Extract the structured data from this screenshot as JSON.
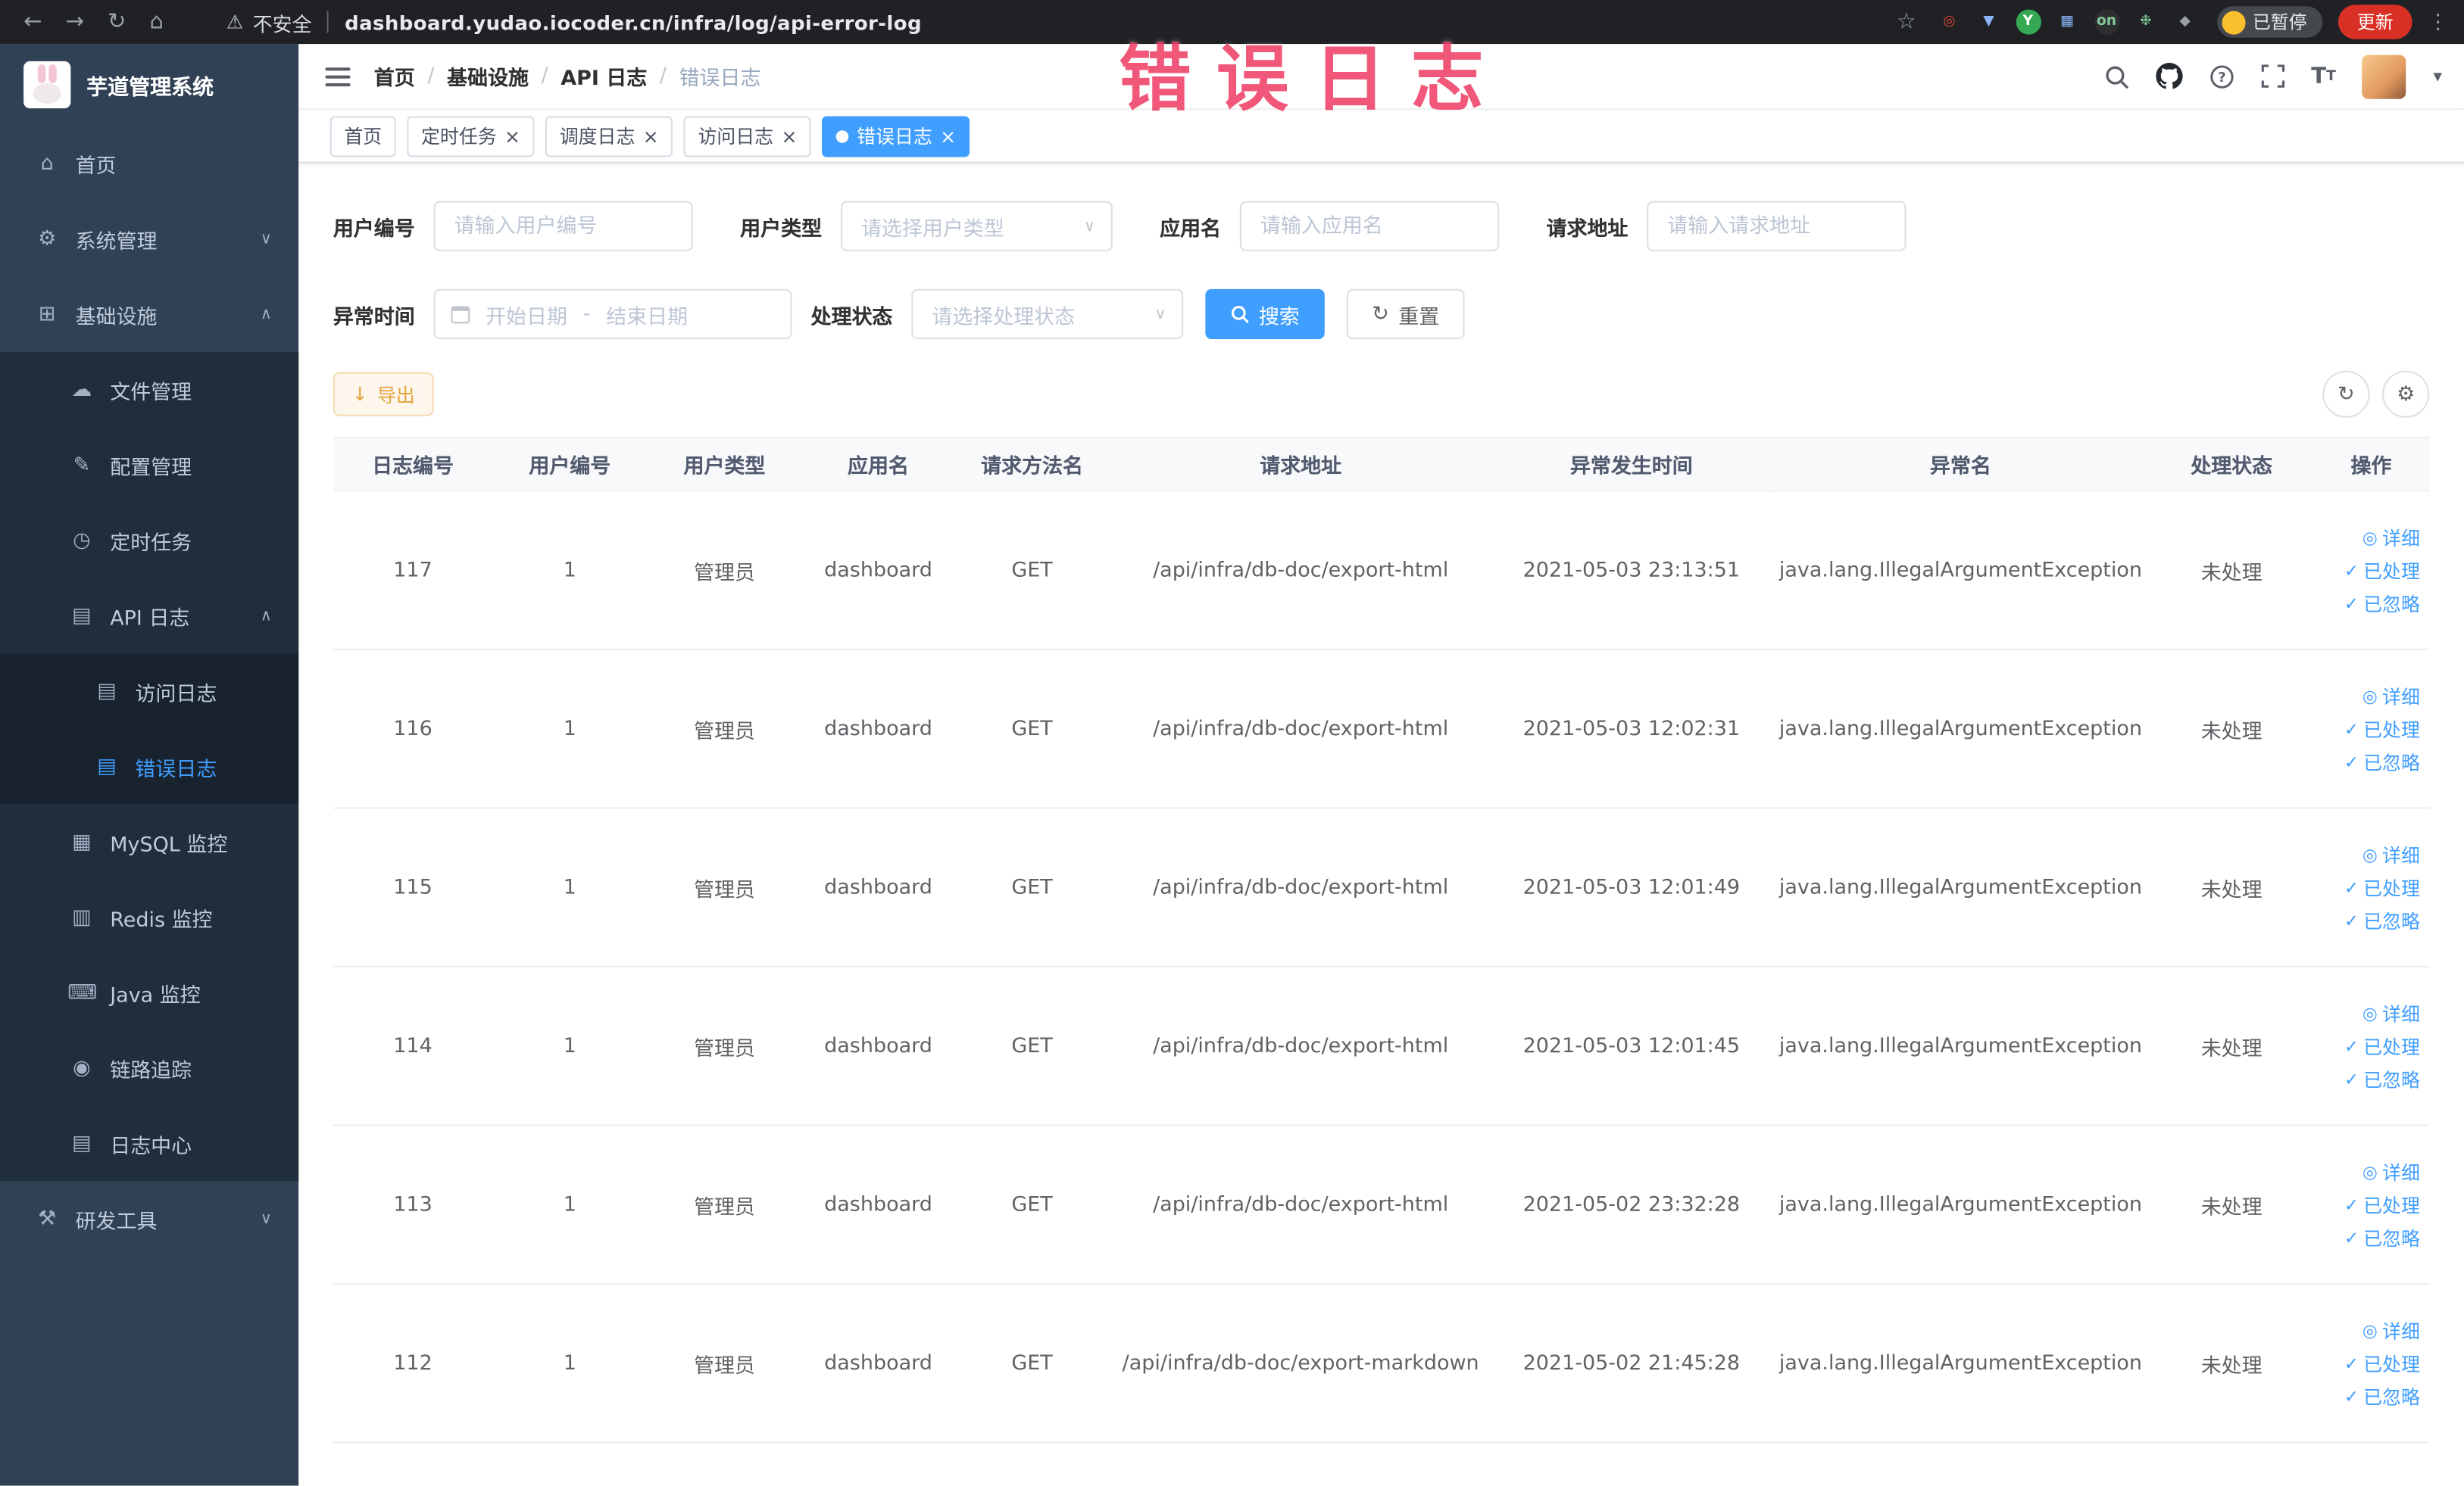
{
  "colors": {
    "accent": "#409eff",
    "warning": "#e6a23c",
    "annotation": "#ee4066",
    "sidebar_bg": "#304156",
    "submenu_bg": "#1f2d3d"
  },
  "browser": {
    "nav_icons": [
      {
        "name": "back-icon",
        "glyph": "←"
      },
      {
        "name": "forward-icon",
        "glyph": "→"
      },
      {
        "name": "reload-icon",
        "glyph": "↻"
      },
      {
        "name": "home-icon",
        "glyph": "⌂"
      }
    ],
    "security_warning_icon": "⚠",
    "security_label": "不安全",
    "url": "dashboard.yudao.iocoder.cn/infra/log/api-error-log",
    "bookmark_star_icon": "☆",
    "extensions": [
      {
        "name": "recorder-icon",
        "glyph": "◎",
        "bg": "#202124",
        "fg": "#ea4335"
      },
      {
        "name": "drop-icon",
        "glyph": "▼",
        "bg": "#202124",
        "fg": "#8ab4f8"
      },
      {
        "name": "green-app-icon",
        "glyph": "Y",
        "bg": "#34a853",
        "fg": "#ffffff"
      },
      {
        "name": "grid-app-icon",
        "glyph": "▦",
        "bg": "#202124",
        "fg": "#8ab4f8"
      },
      {
        "name": "on-badge-icon",
        "glyph": "on",
        "bg": "#2d2f31",
        "fg": "#81c995"
      },
      {
        "name": "leaf-icon",
        "glyph": "❉",
        "bg": "#202124",
        "fg": "#81c995"
      },
      {
        "name": "puzzle-icon",
        "glyph": "◆",
        "bg": "#202124",
        "fg": "#9aa0a6"
      }
    ],
    "paused_badge": "已暂停",
    "update_button": "更新",
    "menu_kebab_icon": "⋮"
  },
  "overlay": {
    "text": "错误日志"
  },
  "sidebar": {
    "logo_title": "芋道管理系统",
    "items": [
      {
        "key": "home",
        "label": "首页",
        "icon": "home-icon",
        "glyph": "⌂",
        "level": 1
      },
      {
        "key": "system",
        "label": "系统管理",
        "icon": "gear-icon",
        "glyph": "⚙",
        "level": 1,
        "arrow": "down"
      },
      {
        "key": "infra",
        "label": "基础设施",
        "icon": "infrastructure-icon",
        "glyph": "⊞",
        "level": 1,
        "arrow": "up"
      },
      {
        "key": "file",
        "label": "文件管理",
        "icon": "file-icon",
        "glyph": "☁",
        "level": 2
      },
      {
        "key": "config",
        "label": "配置管理",
        "icon": "config-icon",
        "glyph": "✎",
        "level": 2
      },
      {
        "key": "job",
        "label": "定时任务",
        "icon": "job-icon",
        "glyph": "◷",
        "level": 2
      },
      {
        "key": "api-log",
        "label": "API 日志",
        "icon": "api-log-icon",
        "glyph": "▤",
        "level": 2,
        "arrow": "up"
      },
      {
        "key": "access-log",
        "label": "访问日志",
        "icon": "access-log-icon",
        "glyph": "▤",
        "level": 3
      },
      {
        "key": "error-log",
        "label": "错误日志",
        "icon": "error-log-icon",
        "glyph": "▤",
        "level": 3,
        "active": true
      },
      {
        "key": "mysql",
        "label": "MySQL 监控",
        "icon": "mysql-icon",
        "glyph": "▦",
        "level": 2
      },
      {
        "key": "redis",
        "label": "Redis 监控",
        "icon": "redis-icon",
        "glyph": "▥",
        "level": 2
      },
      {
        "key": "java",
        "label": "Java 监控",
        "icon": "java-icon",
        "glyph": "⌨",
        "level": 2
      },
      {
        "key": "trace",
        "label": "链路追踪",
        "icon": "trace-icon",
        "glyph": "◉",
        "level": 2
      },
      {
        "key": "log-center",
        "label": "日志中心",
        "icon": "log-center-icon",
        "glyph": "▤",
        "level": 2
      },
      {
        "key": "devtools",
        "label": "研发工具",
        "icon": "devtools-icon",
        "glyph": "⚒",
        "level": 1,
        "arrow": "down"
      }
    ]
  },
  "topbar": {
    "breadcrumb": [
      "首页",
      "基础设施",
      "API 日志",
      "错误日志"
    ]
  },
  "tabs": [
    {
      "key": "home",
      "label": "首页",
      "closable": false,
      "active": false
    },
    {
      "key": "job",
      "label": "定时任务",
      "closable": true,
      "active": false
    },
    {
      "key": "job-log",
      "label": "调度日志",
      "closable": true,
      "active": false
    },
    {
      "key": "access-log",
      "label": "访问日志",
      "closable": true,
      "active": false
    },
    {
      "key": "error-log",
      "label": "错误日志",
      "closable": true,
      "active": true
    }
  ],
  "filters": {
    "user_id": {
      "label": "用户编号",
      "placeholder": "请输入用户编号"
    },
    "user_type": {
      "label": "用户类型",
      "placeholder": "请选择用户类型"
    },
    "app_name": {
      "label": "应用名",
      "placeholder": "请输入应用名"
    },
    "request_url": {
      "label": "请求地址",
      "placeholder": "请输入请求地址"
    },
    "exception_time": {
      "label": "异常时间",
      "start_placeholder": "开始日期",
      "separator": "-",
      "end_placeholder": "结束日期"
    },
    "process_status": {
      "label": "处理状态",
      "placeholder": "请选择处理状态"
    },
    "search_button": "搜索",
    "reset_button": "重置"
  },
  "toolbar": {
    "export_button": "导出"
  },
  "icons": {
    "caret_down": "▾",
    "select_caret": "∨",
    "download": "↓",
    "refresh": "↻",
    "settings": "⚙"
  },
  "table": {
    "headers": [
      "日志编号",
      "用户编号",
      "用户类型",
      "应用名",
      "请求方法名",
      "请求地址",
      "异常发生时间",
      "异常名",
      "处理状态",
      "操作"
    ],
    "actions": [
      {
        "name": "detail-link",
        "icon": "eye-icon",
        "glyph": "◎",
        "label": "详细"
      },
      {
        "name": "mark-processed-link",
        "icon": "check-icon",
        "glyph": "✓",
        "label": "已处理"
      },
      {
        "name": "mark-ignored-link",
        "icon": "check-icon",
        "glyph": "✓",
        "label": "已忽略"
      }
    ],
    "rows": [
      {
        "log_id": "117",
        "user_id": "1",
        "user_type": "管理员",
        "app_name": "dashboard",
        "method": "GET",
        "url": "/api/infra/db-doc/export-html",
        "time": "2021-05-03 23:13:51",
        "exception": "java.lang.IllegalArgumentException",
        "status": "未处理"
      },
      {
        "log_id": "116",
        "user_id": "1",
        "user_type": "管理员",
        "app_name": "dashboard",
        "method": "GET",
        "url": "/api/infra/db-doc/export-html",
        "time": "2021-05-03 12:02:31",
        "exception": "java.lang.IllegalArgumentException",
        "status": "未处理"
      },
      {
        "log_id": "115",
        "user_id": "1",
        "user_type": "管理员",
        "app_name": "dashboard",
        "method": "GET",
        "url": "/api/infra/db-doc/export-html",
        "time": "2021-05-03 12:01:49",
        "exception": "java.lang.IllegalArgumentException",
        "status": "未处理"
      },
      {
        "log_id": "114",
        "user_id": "1",
        "user_type": "管理员",
        "app_name": "dashboard",
        "method": "GET",
        "url": "/api/infra/db-doc/export-html",
        "time": "2021-05-03 12:01:45",
        "exception": "java.lang.IllegalArgumentException",
        "status": "未处理"
      },
      {
        "log_id": "113",
        "user_id": "1",
        "user_type": "管理员",
        "app_name": "dashboard",
        "method": "GET",
        "url": "/api/infra/db-doc/export-html",
        "time": "2021-05-02 23:32:28",
        "exception": "java.lang.IllegalArgumentException",
        "status": "未处理"
      },
      {
        "log_id": "112",
        "user_id": "1",
        "user_type": "管理员",
        "app_name": "dashboard",
        "method": "GET",
        "url": "/api/infra/db-doc/export-markdown",
        "time": "2021-05-02 21:45:28",
        "exception": "java.lang.IllegalArgumentException",
        "status": "未处理"
      }
    ]
  }
}
